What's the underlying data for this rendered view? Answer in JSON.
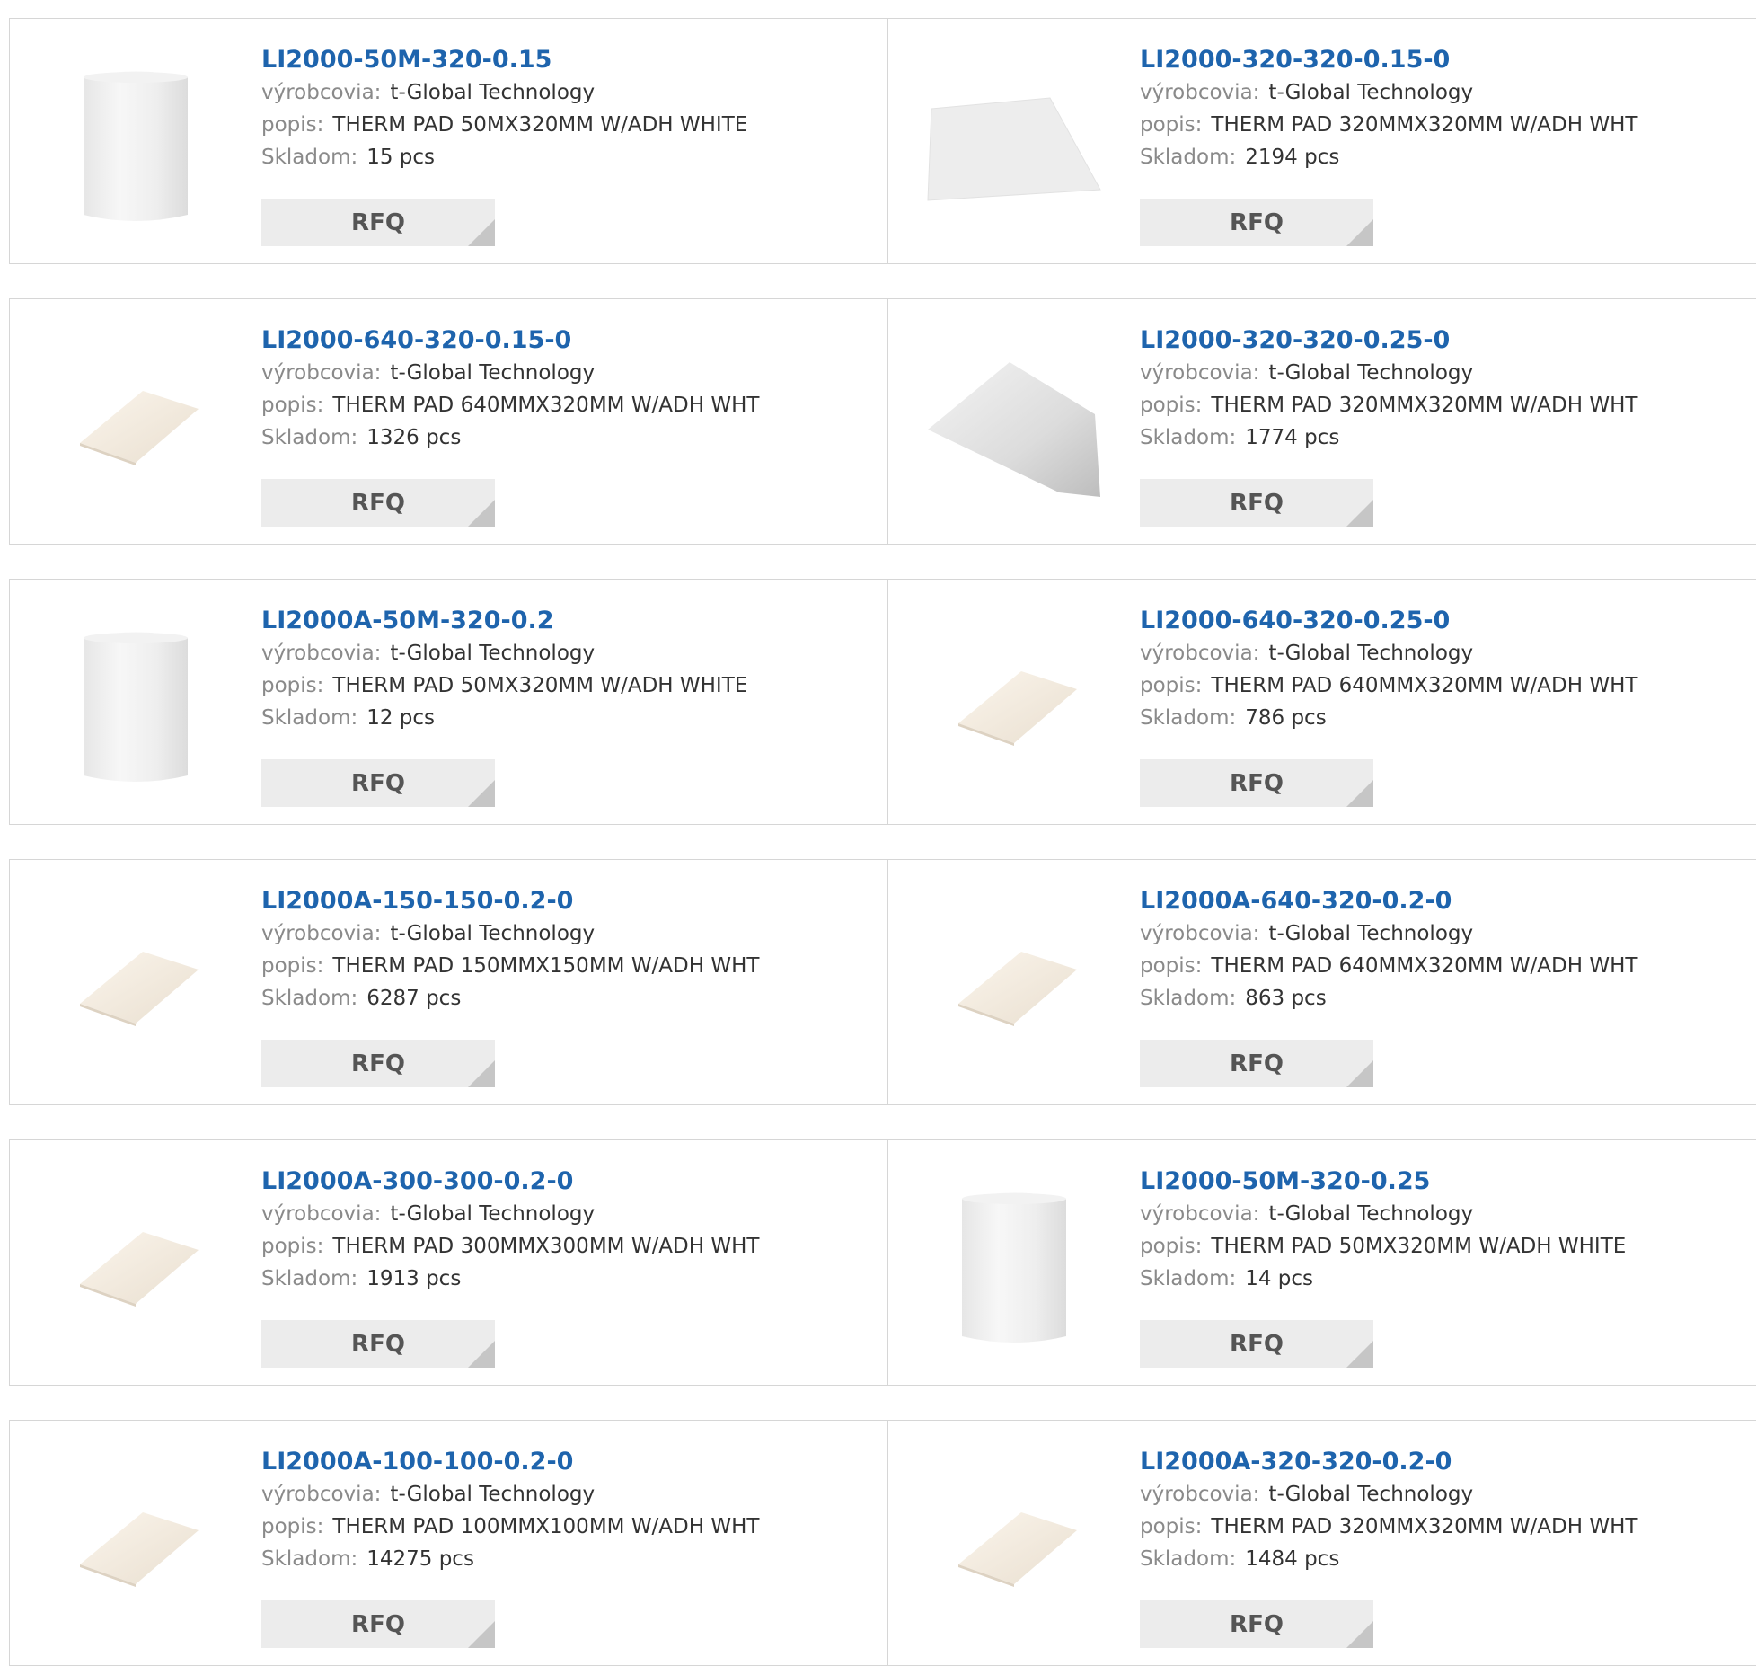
{
  "labels": {
    "manufacturer": "výrobcovia:",
    "description": "popis:",
    "stock": "Skladom:",
    "rfq": "RFQ"
  },
  "products": [
    {
      "part": "LI2000-50M-320-0.15",
      "manufacturer": "t-Global Technology",
      "description": "THERM PAD 50MX320MM W/ADH WHITE",
      "stock": "15 pcs",
      "image": "roll-icon"
    },
    {
      "part": "LI2000-320-320-0.15-0",
      "manufacturer": "t-Global Technology",
      "description": "THERM PAD 320MMX320MM W/ADH WHT",
      "stock": "2194 pcs",
      "image": "sheet-large-icon"
    },
    {
      "part": "LI2000-640-320-0.15-0",
      "manufacturer": "t-Global Technology",
      "description": "THERM PAD 640MMX320MM W/ADH WHT",
      "stock": "1326 pcs",
      "image": "pad-icon"
    },
    {
      "part": "LI2000-320-320-0.25-0",
      "manufacturer": "t-Global Technology",
      "description": "THERM PAD 320MMX320MM W/ADH WHT",
      "stock": "1774 pcs",
      "image": "sheet-gray-icon"
    },
    {
      "part": "LI2000A-50M-320-0.2",
      "manufacturer": "t-Global Technology",
      "description": "THERM PAD 50MX320MM W/ADH WHITE",
      "stock": "12 pcs",
      "image": "roll-icon"
    },
    {
      "part": "LI2000-640-320-0.25-0",
      "manufacturer": "t-Global Technology",
      "description": "THERM PAD 640MMX320MM W/ADH WHT",
      "stock": "786 pcs",
      "image": "pad-icon"
    },
    {
      "part": "LI2000A-150-150-0.2-0",
      "manufacturer": "t-Global Technology",
      "description": "THERM PAD 150MMX150MM W/ADH WHT",
      "stock": "6287 pcs",
      "image": "pad-icon"
    },
    {
      "part": "LI2000A-640-320-0.2-0",
      "manufacturer": "t-Global Technology",
      "description": "THERM PAD 640MMX320MM W/ADH WHT",
      "stock": "863 pcs",
      "image": "pad-icon"
    },
    {
      "part": "LI2000A-300-300-0.2-0",
      "manufacturer": "t-Global Technology",
      "description": "THERM PAD 300MMX300MM W/ADH WHT",
      "stock": "1913 pcs",
      "image": "pad-icon"
    },
    {
      "part": "LI2000-50M-320-0.25",
      "manufacturer": "t-Global Technology",
      "description": "THERM PAD 50MX320MM W/ADH WHITE",
      "stock": "14 pcs",
      "image": "roll-icon"
    },
    {
      "part": "LI2000A-100-100-0.2-0",
      "manufacturer": "t-Global Technology",
      "description": "THERM PAD 100MMX100MM W/ADH WHT",
      "stock": "14275 pcs",
      "image": "pad-icon"
    },
    {
      "part": "LI2000A-320-320-0.2-0",
      "manufacturer": "t-Global Technology",
      "description": "THERM PAD 320MMX320MM W/ADH WHT",
      "stock": "1484 pcs",
      "image": "pad-icon"
    }
  ],
  "colors": {
    "part_link": "#1e64ad",
    "label": "#8a8a8a",
    "value": "#333333",
    "rfq_bg": "#ececec",
    "border": "#d6d6d6"
  }
}
